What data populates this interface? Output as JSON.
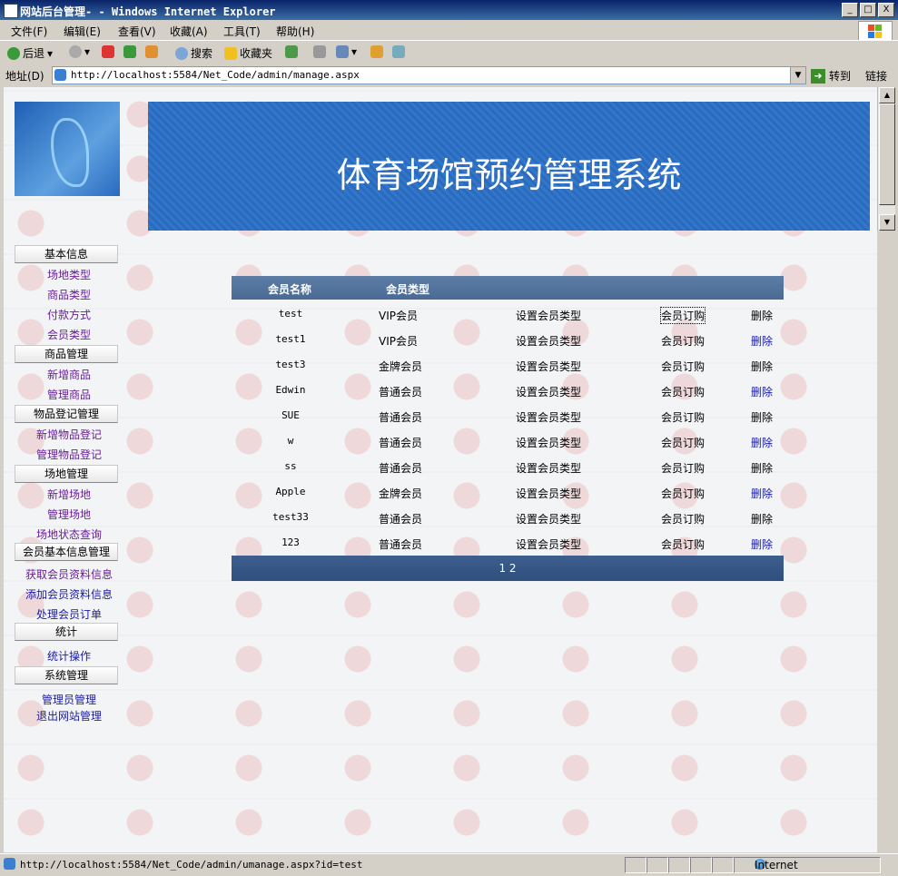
{
  "window": {
    "title": "网站后台管理- - Windows Internet Explorer",
    "minimize": "_",
    "maximize": "□",
    "close": "X"
  },
  "menu": [
    "文件(F)",
    "编辑(E)",
    "查看(V)",
    "收藏(A)",
    "工具(T)",
    "帮助(H)"
  ],
  "toolbar": {
    "back": "后退",
    "search": "搜索",
    "favorites": "收藏夹"
  },
  "address": {
    "label": "地址(D)",
    "url": "http://localhost:5584/Net_Code/admin/manage.aspx",
    "go": "转到",
    "links": "链接"
  },
  "banner": {
    "title": "体育场馆预约管理系统"
  },
  "sidebar": {
    "sections": [
      {
        "label": "基本信息",
        "items": [
          "场地类型",
          "商品类型",
          "付款方式",
          "会员类型"
        ]
      },
      {
        "label": "商品管理",
        "items": [
          "新增商品",
          "管理商品"
        ]
      },
      {
        "label": "物品登记管理",
        "items": [
          "新增物品登记",
          "管理物品登记"
        ]
      },
      {
        "label": "场地管理",
        "items": [
          "新增场地",
          "管理场地",
          "场地状态查询"
        ]
      },
      {
        "label": "会员基本信息管理",
        "items": [
          "获取会员资料信息",
          "添加会员资料信息",
          "处理会员订单"
        ]
      },
      {
        "label": "统计",
        "items": [
          "统计操作"
        ]
      },
      {
        "label": "系统管理",
        "items": [
          "管理员管理",
          "退出网站管理"
        ]
      }
    ]
  },
  "grid": {
    "headers": [
      "会员名称",
      "会员类型"
    ],
    "rows": [
      {
        "name": "test",
        "type": "VIP会员",
        "set": "设置会员类型",
        "order": "会员订购",
        "del": "删除"
      },
      {
        "name": "test1",
        "type": "VIP会员",
        "set": "设置会员类型",
        "order": "会员订购",
        "del": "删除"
      },
      {
        "name": "test3",
        "type": "金牌会员",
        "set": "设置会员类型",
        "order": "会员订购",
        "del": "删除"
      },
      {
        "name": "Edwin",
        "type": "普通会员",
        "set": "设置会员类型",
        "order": "会员订购",
        "del": "删除"
      },
      {
        "name": "SUE",
        "type": "普通会员",
        "set": "设置会员类型",
        "order": "会员订购",
        "del": "删除"
      },
      {
        "name": "w",
        "type": "普通会员",
        "set": "设置会员类型",
        "order": "会员订购",
        "del": "删除"
      },
      {
        "name": "ss",
        "type": "普通会员",
        "set": "设置会员类型",
        "order": "会员订购",
        "del": "删除"
      },
      {
        "name": "Apple",
        "type": "金牌会员",
        "set": "设置会员类型",
        "order": "会员订购",
        "del": "删除"
      },
      {
        "name": "test33",
        "type": "普通会员",
        "set": "设置会员类型",
        "order": "会员订购",
        "del": "删除"
      },
      {
        "name": "123",
        "type": "普通会员",
        "set": "设置会员类型",
        "order": "会员订购",
        "del": "删除"
      }
    ],
    "pager": "1 2"
  },
  "status": {
    "url": "http://localhost:5584/Net_Code/admin/umanage.aspx?id=test",
    "zone": "Internet"
  }
}
